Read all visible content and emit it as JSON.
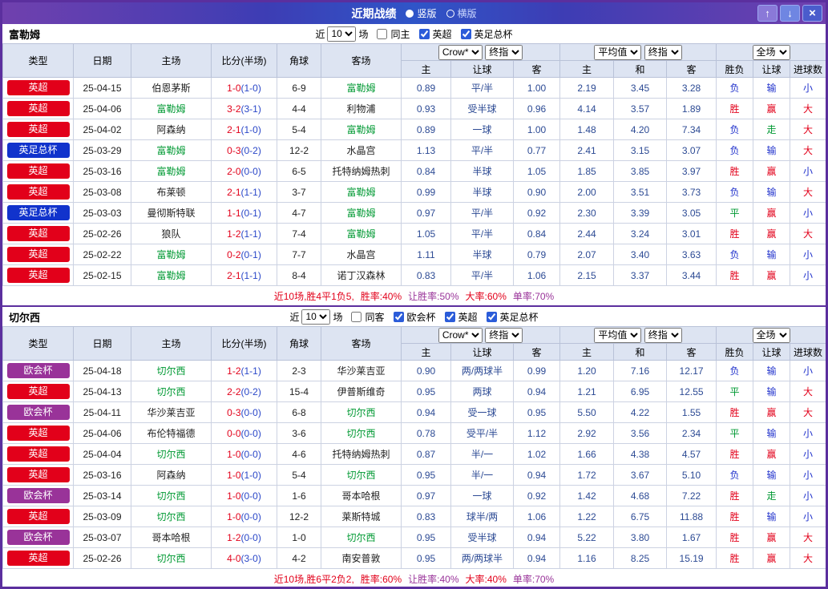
{
  "titlebar": {
    "title": "近期战绩",
    "layout_options": [
      {
        "label": "竖版",
        "selected": true
      },
      {
        "label": "横版",
        "selected": false
      }
    ],
    "up_icon": "↑",
    "down_icon": "↓",
    "close_icon": "×"
  },
  "cols": {
    "type": "类型",
    "date": "日期",
    "home": "主场",
    "score": "比分(半场)",
    "corner": "角球",
    "away": "客场",
    "home2": "主",
    "handicap": "让球",
    "away2": "客",
    "draw": "和",
    "result": "胜负",
    "goals": "进球数",
    "crown_select": "Crow*",
    "final_select": "终指",
    "avg_select": "平均值",
    "full_select": "全场"
  },
  "colors": {
    "league": {
      "英超": "#e2001a",
      "英足总杯": "#1133cc",
      "欧会杯": "#993399"
    },
    "outcome": {
      "胜": "#e2001a",
      "平": "#009933",
      "负": "#2233cc",
      "赢": "#e2001a",
      "走": "#009933",
      "输": "#2233cc",
      "大": "#e2001a",
      "小": "#2233cc"
    }
  },
  "sections": [
    {
      "team": "富勒姆",
      "filter": {
        "near": "近",
        "count": "10",
        "games": "场",
        "same": "同主",
        "same_checked": false,
        "leagues": [
          {
            "label": "英超",
            "checked": true
          },
          {
            "label": "英足总杯",
            "checked": true
          }
        ]
      },
      "rows": [
        {
          "league": "英超",
          "date": "25-04-15",
          "home": "伯恩茅斯",
          "home_hl": false,
          "score": "1-0",
          "half": "(1-0)",
          "corner": "6-9",
          "away": "富勒姆",
          "away_hl": true,
          "crow": [
            "0.89",
            "平/半",
            "1.00"
          ],
          "avg": [
            "2.19",
            "3.45",
            "3.28"
          ],
          "outcome": [
            "负",
            "输",
            "小"
          ]
        },
        {
          "league": "英超",
          "date": "25-04-06",
          "home": "富勒姆",
          "home_hl": true,
          "score": "3-2",
          "half": "(3-1)",
          "corner": "4-4",
          "away": "利物浦",
          "away_hl": false,
          "crow": [
            "0.93",
            "受半球",
            "0.96"
          ],
          "avg": [
            "4.14",
            "3.57",
            "1.89"
          ],
          "outcome": [
            "胜",
            "赢",
            "大"
          ]
        },
        {
          "league": "英超",
          "date": "25-04-02",
          "home": "阿森纳",
          "home_hl": false,
          "score": "2-1",
          "half": "(1-0)",
          "corner": "5-4",
          "away": "富勒姆",
          "away_hl": true,
          "crow": [
            "0.89",
            "一球",
            "1.00"
          ],
          "avg": [
            "1.48",
            "4.20",
            "7.34"
          ],
          "outcome": [
            "负",
            "走",
            "大"
          ]
        },
        {
          "league": "英足总杯",
          "date": "25-03-29",
          "home": "富勒姆",
          "home_hl": true,
          "score": "0-3",
          "half": "(0-2)",
          "corner": "12-2",
          "away": "水晶宫",
          "away_hl": false,
          "crow": [
            "1.13",
            "平/半",
            "0.77"
          ],
          "avg": [
            "2.41",
            "3.15",
            "3.07"
          ],
          "outcome": [
            "负",
            "输",
            "大"
          ]
        },
        {
          "league": "英超",
          "date": "25-03-16",
          "home": "富勒姆",
          "home_hl": true,
          "score": "2-0",
          "half": "(0-0)",
          "corner": "6-5",
          "away": "托特纳姆热刺",
          "away_hl": false,
          "crow": [
            "0.84",
            "半球",
            "1.05"
          ],
          "avg": [
            "1.85",
            "3.85",
            "3.97"
          ],
          "outcome": [
            "胜",
            "赢",
            "小"
          ]
        },
        {
          "league": "英超",
          "date": "25-03-08",
          "home": "布莱顿",
          "home_hl": false,
          "score": "2-1",
          "half": "(1-1)",
          "corner": "3-7",
          "away": "富勒姆",
          "away_hl": true,
          "crow": [
            "0.99",
            "半球",
            "0.90"
          ],
          "avg": [
            "2.00",
            "3.51",
            "3.73"
          ],
          "outcome": [
            "负",
            "输",
            "大"
          ]
        },
        {
          "league": "英足总杯",
          "date": "25-03-03",
          "home": "曼彻斯特联",
          "home_hl": false,
          "score": "1-1",
          "half": "(0-1)",
          "corner": "4-7",
          "away": "富勒姆",
          "away_hl": true,
          "crow": [
            "0.97",
            "平/半",
            "0.92"
          ],
          "avg": [
            "2.30",
            "3.39",
            "3.05"
          ],
          "outcome": [
            "平",
            "赢",
            "小"
          ]
        },
        {
          "league": "英超",
          "date": "25-02-26",
          "home": "狼队",
          "home_hl": false,
          "score": "1-2",
          "half": "(1-1)",
          "corner": "7-4",
          "away": "富勒姆",
          "away_hl": true,
          "crow": [
            "1.05",
            "平/半",
            "0.84"
          ],
          "avg": [
            "2.44",
            "3.24",
            "3.01"
          ],
          "outcome": [
            "胜",
            "赢",
            "大"
          ]
        },
        {
          "league": "英超",
          "date": "25-02-22",
          "home": "富勒姆",
          "home_hl": true,
          "score": "0-2",
          "half": "(0-1)",
          "corner": "7-7",
          "away": "水晶宫",
          "away_hl": false,
          "crow": [
            "1.11",
            "半球",
            "0.79"
          ],
          "avg": [
            "2.07",
            "3.40",
            "3.63"
          ],
          "outcome": [
            "负",
            "输",
            "小"
          ]
        },
        {
          "league": "英超",
          "date": "25-02-15",
          "home": "富勒姆",
          "home_hl": true,
          "score": "2-1",
          "half": "(1-1)",
          "corner": "8-4",
          "away": "诺丁汉森林",
          "away_hl": false,
          "crow": [
            "0.83",
            "平/半",
            "1.06"
          ],
          "avg": [
            "2.15",
            "3.37",
            "3.44"
          ],
          "outcome": [
            "胜",
            "赢",
            "小"
          ]
        }
      ],
      "summary": [
        {
          "t": "近10场,胜4平1负5,",
          "c": "#e2001a"
        },
        {
          "t": "胜率:40%",
          "c": "#e2001a"
        },
        {
          "t": "让胜率:50%",
          "c": "#993399"
        },
        {
          "t": "大率:60%",
          "c": "#e2001a"
        },
        {
          "t": "单率:70%",
          "c": "#993399"
        }
      ]
    },
    {
      "team": "切尔西",
      "filter": {
        "near": "近",
        "count": "10",
        "games": "场",
        "same": "同客",
        "same_checked": false,
        "leagues": [
          {
            "label": "欧会杯",
            "checked": true
          },
          {
            "label": "英超",
            "checked": true
          },
          {
            "label": "英足总杯",
            "checked": true
          }
        ]
      },
      "rows": [
        {
          "league": "欧会杯",
          "date": "25-04-18",
          "home": "切尔西",
          "home_hl": true,
          "score": "1-2",
          "half": "(1-1)",
          "corner": "2-3",
          "away": "华沙莱吉亚",
          "away_hl": false,
          "crow": [
            "0.90",
            "两/两球半",
            "0.99"
          ],
          "avg": [
            "1.20",
            "7.16",
            "12.17"
          ],
          "outcome": [
            "负",
            "输",
            "小"
          ]
        },
        {
          "league": "英超",
          "date": "25-04-13",
          "home": "切尔西",
          "home_hl": true,
          "score": "2-2",
          "half": "(0-2)",
          "corner": "15-4",
          "away": "伊普斯维奇",
          "away_hl": false,
          "crow": [
            "0.95",
            "两球",
            "0.94"
          ],
          "avg": [
            "1.21",
            "6.95",
            "12.55"
          ],
          "outcome": [
            "平",
            "输",
            "大"
          ]
        },
        {
          "league": "欧会杯",
          "date": "25-04-11",
          "home": "华沙莱吉亚",
          "home_hl": false,
          "score": "0-3",
          "half": "(0-0)",
          "corner": "6-8",
          "away": "切尔西",
          "away_hl": true,
          "crow": [
            "0.94",
            "受一球",
            "0.95"
          ],
          "avg": [
            "5.50",
            "4.22",
            "1.55"
          ],
          "outcome": [
            "胜",
            "赢",
            "大"
          ]
        },
        {
          "league": "英超",
          "date": "25-04-06",
          "home": "布伦特福德",
          "home_hl": false,
          "score": "0-0",
          "half": "(0-0)",
          "corner": "3-6",
          "away": "切尔西",
          "away_hl": true,
          "crow": [
            "0.78",
            "受平/半",
            "1.12"
          ],
          "avg": [
            "2.92",
            "3.56",
            "2.34"
          ],
          "outcome": [
            "平",
            "输",
            "小"
          ]
        },
        {
          "league": "英超",
          "date": "25-04-04",
          "home": "切尔西",
          "home_hl": true,
          "score": "1-0",
          "half": "(0-0)",
          "corner": "4-6",
          "away": "托特纳姆热刺",
          "away_hl": false,
          "crow": [
            "0.87",
            "半/一",
            "1.02"
          ],
          "avg": [
            "1.66",
            "4.38",
            "4.57"
          ],
          "outcome": [
            "胜",
            "赢",
            "小"
          ]
        },
        {
          "league": "英超",
          "date": "25-03-16",
          "home": "阿森纳",
          "home_hl": false,
          "score": "1-0",
          "half": "(1-0)",
          "corner": "5-4",
          "away": "切尔西",
          "away_hl": true,
          "crow": [
            "0.95",
            "半/一",
            "0.94"
          ],
          "avg": [
            "1.72",
            "3.67",
            "5.10"
          ],
          "outcome": [
            "负",
            "输",
            "小"
          ]
        },
        {
          "league": "欧会杯",
          "date": "25-03-14",
          "home": "切尔西",
          "home_hl": true,
          "score": "1-0",
          "half": "(0-0)",
          "corner": "1-6",
          "away": "哥本哈根",
          "away_hl": false,
          "crow": [
            "0.97",
            "一球",
            "0.92"
          ],
          "avg": [
            "1.42",
            "4.68",
            "7.22"
          ],
          "outcome": [
            "胜",
            "走",
            "小"
          ]
        },
        {
          "league": "英超",
          "date": "25-03-09",
          "home": "切尔西",
          "home_hl": true,
          "score": "1-0",
          "half": "(0-0)",
          "corner": "12-2",
          "away": "莱斯特城",
          "away_hl": false,
          "crow": [
            "0.83",
            "球半/两",
            "1.06"
          ],
          "avg": [
            "1.22",
            "6.75",
            "11.88"
          ],
          "outcome": [
            "胜",
            "输",
            "小"
          ]
        },
        {
          "league": "欧会杯",
          "date": "25-03-07",
          "home": "哥本哈根",
          "home_hl": false,
          "score": "1-2",
          "half": "(0-0)",
          "corner": "1-0",
          "away": "切尔西",
          "away_hl": true,
          "crow": [
            "0.95",
            "受半球",
            "0.94"
          ],
          "avg": [
            "5.22",
            "3.80",
            "1.67"
          ],
          "outcome": [
            "胜",
            "赢",
            "大"
          ]
        },
        {
          "league": "英超",
          "date": "25-02-26",
          "home": "切尔西",
          "home_hl": true,
          "score": "4-0",
          "half": "(3-0)",
          "corner": "4-2",
          "away": "南安普敦",
          "away_hl": false,
          "crow": [
            "0.95",
            "两/两球半",
            "0.94"
          ],
          "avg": [
            "1.16",
            "8.25",
            "15.19"
          ],
          "outcome": [
            "胜",
            "赢",
            "大"
          ]
        }
      ],
      "summary": [
        {
          "t": "近10场,胜6平2负2,",
          "c": "#e2001a"
        },
        {
          "t": "胜率:60%",
          "c": "#e2001a"
        },
        {
          "t": "让胜率:40%",
          "c": "#993399"
        },
        {
          "t": "大率:40%",
          "c": "#e2001a"
        },
        {
          "t": "单率:70%",
          "c": "#993399"
        }
      ]
    }
  ]
}
